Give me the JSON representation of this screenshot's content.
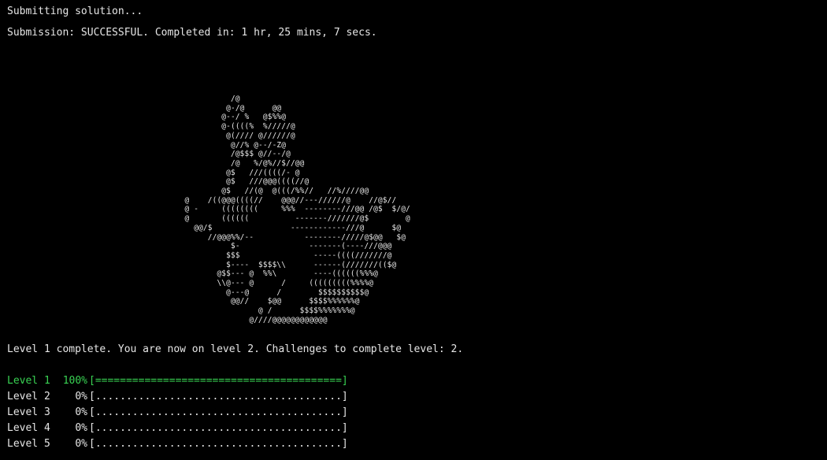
{
  "terminal": {
    "line1": "Submitting solution...",
    "line2": "Submission: SUCCESSFUL. Completed in: 1 hr, 25 mins, 7 secs.",
    "level_message": "Level 1 complete. You are now on level 2. Challenges to complete level: 2.",
    "ascii_art": "             /@\n            @-/@      @@\n           @--/ %   @$%%@\n           @-((((%  %/////@\n            @(//// @//////@\n             @//% @--/-Z@\n             /@$$$ @//--/@\n             /@   %/@%//$//@@\n            @$   ///((((/- @\n            @$   ///@@@((((//@\n           @$   //(@  @(((/%%//   //%////@@\n   @    /((@@@((((//    @@@//---//////@    //@$//\n   @ -     ((((((((     %%%  --------///@@ /@$  $/@/\n   @       ((((((          -------///////@$        @\n     @@/$                 ------------///@      $@\n        //@@@%%/--           --------/////@$@@   $@\n             $-               -------(----///@@@\n            $$$                -----((((///////@\n            $----  $$$$\\\\      ------(///////(($@\n          @$$--- @  %%\\        ----((((((%%%@\n          \\\\@--- @      /     (((((((((%%%%@\n            @---@      /        $$$$$$$$$$@\n             @@//    $@@      $$$$%%%%%%@\n                   @ /      $$$$%%%%%%%@\n                 @////@@@@@@@@@@@@"
  },
  "progress": [
    {
      "name": "Level 1",
      "percent": "100%",
      "bar": "[========================================]",
      "complete": true
    },
    {
      "name": "Level 2",
      "percent": "0%",
      "bar": "[........................................]",
      "complete": false
    },
    {
      "name": "Level 3",
      "percent": "0%",
      "bar": "[........................................]",
      "complete": false
    },
    {
      "name": "Level 4",
      "percent": "0%",
      "bar": "[........................................]",
      "complete": false
    },
    {
      "name": "Level 5",
      "percent": "0%",
      "bar": "[........................................]",
      "complete": false
    }
  ],
  "colors": {
    "background": "#000000",
    "text": "#e6e6e6",
    "complete_level": "#39d353"
  }
}
